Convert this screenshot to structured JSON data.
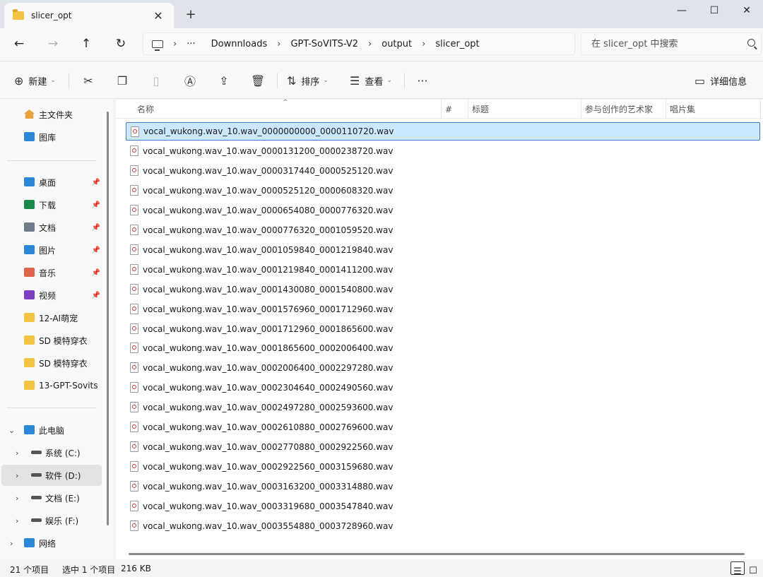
{
  "tab": {
    "title": "slicer_opt",
    "close_glyph": "✕",
    "new_tab_glyph": "+"
  },
  "window_buttons": {
    "minimize": "—",
    "maximize": "☐",
    "close": "✕"
  },
  "nav": {
    "back": "←",
    "forward": "→",
    "up": "↑",
    "refresh": "↻"
  },
  "address": {
    "ellipsis": "···",
    "crumbs": [
      "Downnloads",
      "GPT-SoVITS-V2",
      "output",
      "slicer_opt"
    ],
    "separator": "›"
  },
  "search": {
    "placeholder": "在 slicer_opt 中搜索"
  },
  "toolbar": {
    "new_label": "新建",
    "sort_label": "排序",
    "view_label": "查看",
    "more": "···",
    "details_label": "详细信息"
  },
  "sidebar": {
    "quick": [
      {
        "label": "主文件夹",
        "icon": "home-icon"
      },
      {
        "label": "图库",
        "icon": "gallery-icon"
      }
    ],
    "pinned": [
      {
        "label": "桌面",
        "icon": "desktop-icon",
        "color": "#2b88d8"
      },
      {
        "label": "下载",
        "icon": "download-icon",
        "color": "#1a8a4a"
      },
      {
        "label": "文档",
        "icon": "document-icon",
        "color": "#6d7b8a"
      },
      {
        "label": "图片",
        "icon": "pictures-icon",
        "color": "#2b88d8"
      },
      {
        "label": "音乐",
        "icon": "music-icon",
        "color": "#e0644a"
      },
      {
        "label": "视频",
        "icon": "video-icon",
        "color": "#7a3fc2"
      },
      {
        "label": "12-AI萌宠",
        "icon": "folder-icon",
        "color": "#f5c342"
      },
      {
        "label": "SD 模特穿衣",
        "icon": "folder-icon",
        "color": "#f5c342"
      },
      {
        "label": "SD 模特穿衣",
        "icon": "folder-icon",
        "color": "#f5c342"
      },
      {
        "label": "13-GPT-Sovits",
        "icon": "folder-icon",
        "color": "#f5c342"
      }
    ],
    "this_pc": {
      "label": "此电脑"
    },
    "drives": [
      {
        "label": "系统 (C:)"
      },
      {
        "label": "软件 (D:)"
      },
      {
        "label": "文档 (E:)"
      },
      {
        "label": "娱乐 (F:)"
      }
    ],
    "network": {
      "label": "网络"
    }
  },
  "columns": {
    "name": "名称",
    "number": "#",
    "title": "标题",
    "artists": "参与创作的艺术家",
    "album": "唱片集"
  },
  "files": [
    "vocal_wukong.wav_10.wav_0000000000_0000110720.wav",
    "vocal_wukong.wav_10.wav_0000131200_0000238720.wav",
    "vocal_wukong.wav_10.wav_0000317440_0000525120.wav",
    "vocal_wukong.wav_10.wav_0000525120_0000608320.wav",
    "vocal_wukong.wav_10.wav_0000654080_0000776320.wav",
    "vocal_wukong.wav_10.wav_0000776320_0001059520.wav",
    "vocal_wukong.wav_10.wav_0001059840_0001219840.wav",
    "vocal_wukong.wav_10.wav_0001219840_0001411200.wav",
    "vocal_wukong.wav_10.wav_0001430080_0001540800.wav",
    "vocal_wukong.wav_10.wav_0001576960_0001712960.wav",
    "vocal_wukong.wav_10.wav_0001712960_0001865600.wav",
    "vocal_wukong.wav_10.wav_0001865600_0002006400.wav",
    "vocal_wukong.wav_10.wav_0002006400_0002297280.wav",
    "vocal_wukong.wav_10.wav_0002304640_0002490560.wav",
    "vocal_wukong.wav_10.wav_0002497280_0002593600.wav",
    "vocal_wukong.wav_10.wav_0002610880_0002769600.wav",
    "vocal_wukong.wav_10.wav_0002770880_0002922560.wav",
    "vocal_wukong.wav_10.wav_0002922560_0003159680.wav",
    "vocal_wukong.wav_10.wav_0003163200_0003314880.wav",
    "vocal_wukong.wav_10.wav_0003319680_0003547840.wav",
    "vocal_wukong.wav_10.wav_0003554880_0003728960.wav"
  ],
  "selected_file_index": 0,
  "status": {
    "count": "21 个项目",
    "selected": "选中 1 个项目",
    "size": "216 KB"
  },
  "colors": {
    "selection_bg": "#cce8ff",
    "selection_border": "#3d7cc9",
    "folder": "#f5c342"
  }
}
